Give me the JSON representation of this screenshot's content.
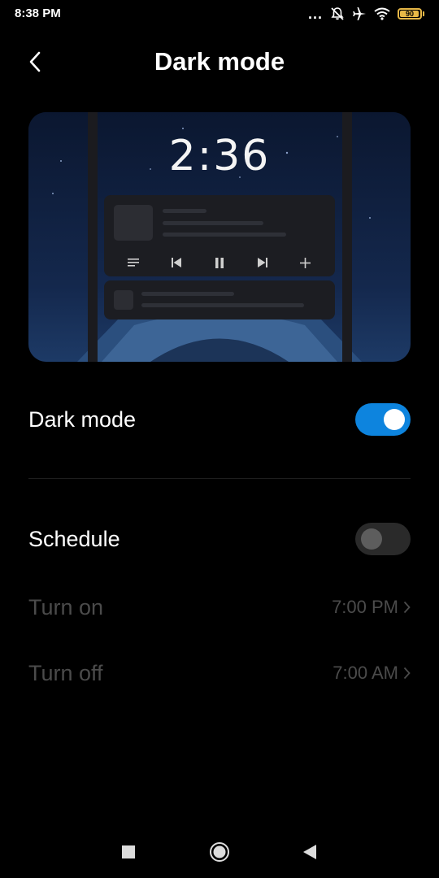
{
  "status_bar": {
    "time": "8:38 PM",
    "icons": [
      "more-dots-icon",
      "notifications-off-icon",
      "airplane-icon",
      "wifi-icon",
      "battery-icon"
    ],
    "more_dots": "...",
    "battery_level": "90",
    "battery_fraction": 0.9,
    "battery_color": "#e7b847"
  },
  "header": {
    "back_icon": "back-arrow-icon",
    "title": "Dark mode"
  },
  "preview": {
    "lock_time": "2:36",
    "media_icons": [
      "menu-icon",
      "previous-icon",
      "pause-icon",
      "next-icon",
      "plus-icon"
    ]
  },
  "settings": {
    "dark_mode": {
      "label": "Dark mode",
      "enabled": true
    },
    "schedule": {
      "label": "Schedule",
      "enabled": false
    },
    "turn_on": {
      "label": "Turn on",
      "value": "7:00 PM"
    },
    "turn_off": {
      "label": "Turn off",
      "value": "7:00 AM"
    }
  },
  "nav_bar": {
    "icons": [
      "recents-square-icon",
      "home-circle-icon",
      "back-triangle-icon"
    ]
  },
  "colors": {
    "background": "#000000",
    "accent": "#0d84de",
    "text_primary": "#ffffff",
    "text_disabled": "#4b4b4b"
  }
}
